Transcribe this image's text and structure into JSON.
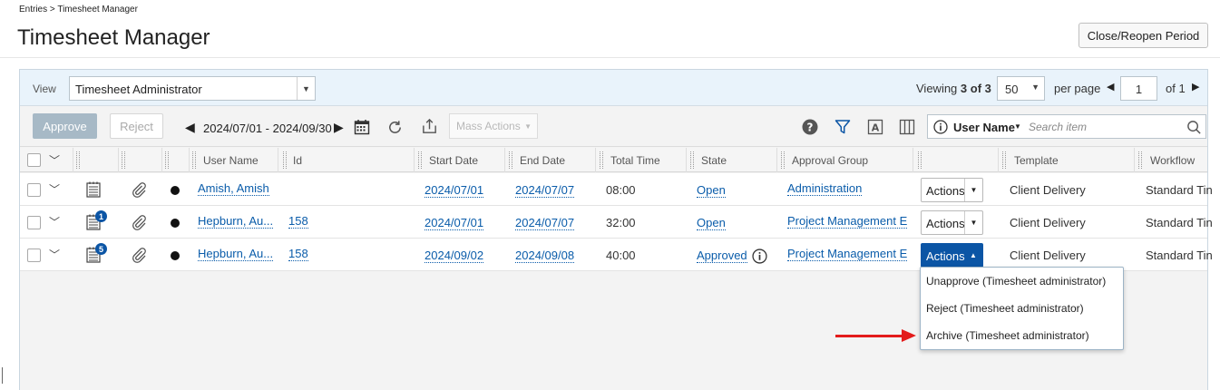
{
  "breadcrumb": "Entries > Timesheet Manager",
  "page_title": "Timesheet Manager",
  "close_reopen_label": "Close/Reopen Period",
  "viewbar": {
    "view_label": "View",
    "view_value": "Timesheet Administrator",
    "viewing_prefix": "Viewing",
    "viewing_count": "3 of 3",
    "per_page_value": "50",
    "per_page_label": "per page",
    "page_value": "1",
    "page_of": "of 1"
  },
  "toolbar": {
    "approve_label": "Approve",
    "reject_label": "Reject",
    "date_range": "2024/07/01 - 2024/09/30",
    "mass_actions_label": "Mass Actions",
    "search_field": "User Name",
    "search_placeholder": "Search item"
  },
  "columns": [
    "User Name",
    "Id",
    "Start Date",
    "End Date",
    "Total Time",
    "State",
    "Approval Group",
    "Template",
    "Workflow"
  ],
  "rows": [
    {
      "user": "Amish, Amish",
      "id": "",
      "start": "2024/07/01",
      "end": "2024/07/07",
      "total": "08:00",
      "state": "Open",
      "group": "Administration",
      "actions": "Actions",
      "template": "Client Delivery",
      "workflow": "Standard Tin",
      "badge": ""
    },
    {
      "user": "Hepburn, Au...",
      "id": "158",
      "start": "2024/07/01",
      "end": "2024/07/07",
      "total": "32:00",
      "state": "Open",
      "group": "Project Management E",
      "actions": "Actions",
      "template": "Client Delivery",
      "workflow": "Standard Tin",
      "badge": "1"
    },
    {
      "user": "Hepburn, Au...",
      "id": "158",
      "start": "2024/09/02",
      "end": "2024/09/08",
      "total": "40:00",
      "state": "Approved",
      "group": "Project Management E",
      "actions": "Actions",
      "template": "Client Delivery",
      "workflow": "Standard Tin",
      "badge": "5"
    }
  ],
  "action_menu": [
    "Unapprove (Timesheet administrator)",
    "Reject (Timesheet administrator)",
    "Archive (Timesheet administrator)"
  ],
  "colors": {
    "link": "#0a5caa",
    "primary": "#0b55a5",
    "annotation_arrow": "#e31b1b"
  }
}
